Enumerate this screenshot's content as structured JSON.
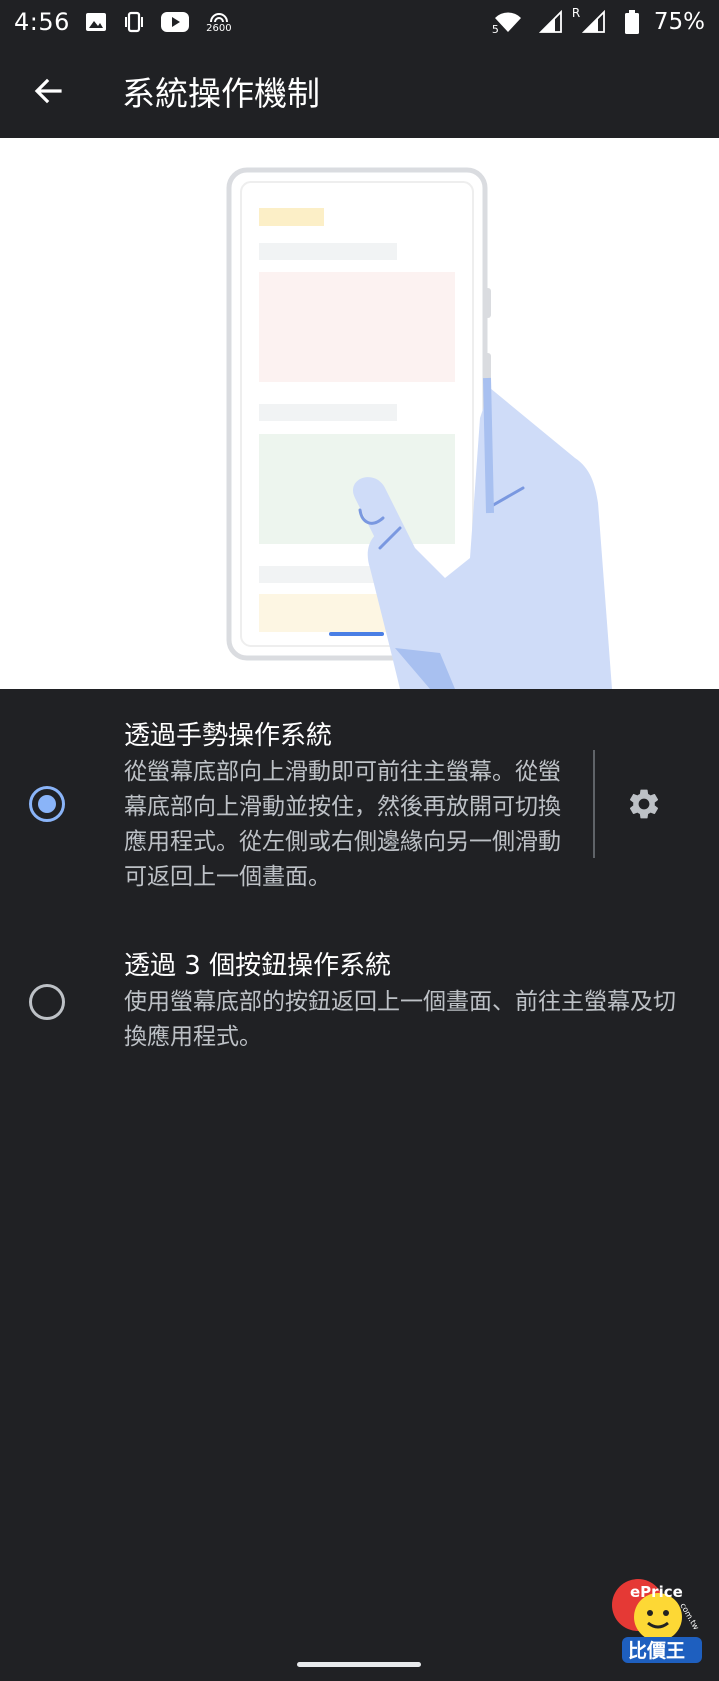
{
  "status_bar": {
    "time": "4:56",
    "left_icons": [
      "image-icon",
      "vibrate-icon",
      "youtube-icon",
      "nfc-2600-icon"
    ],
    "nfc_label": "2600",
    "right_icons": [
      "wifi-icon",
      "signal-icon",
      "signal-roaming-icon",
      "battery-icon"
    ],
    "wifi_label": "5",
    "roaming_label": "R",
    "battery_percent": "75%"
  },
  "app_bar": {
    "title": "系統操作機制",
    "back_icon": "arrow-back-icon"
  },
  "options": {
    "gesture": {
      "title": "透過手勢操作系統",
      "summary": "從螢幕底部向上滑動即可前往主螢幕。從螢幕底部向上滑動並按住，然後再放開可切換應用程式。從左側或右側邊緣向另一側滑動可返回上一個畫面。",
      "selected": true,
      "settings_icon": "gear-icon"
    },
    "three_button": {
      "title": "透過 3 個按鈕操作系統",
      "summary": "使用螢幕底部的按鈕返回上一個畫面、前往主螢幕及切換應用程式。",
      "selected": false
    }
  },
  "watermark": {
    "brand": "ePrice",
    "domain": "com.tw",
    "name": "比價王"
  },
  "colors": {
    "background": "#202124",
    "accent": "#8ab4f8",
    "radio_unchecked": "#bdc1c6",
    "hand": "#c9d7f6"
  }
}
